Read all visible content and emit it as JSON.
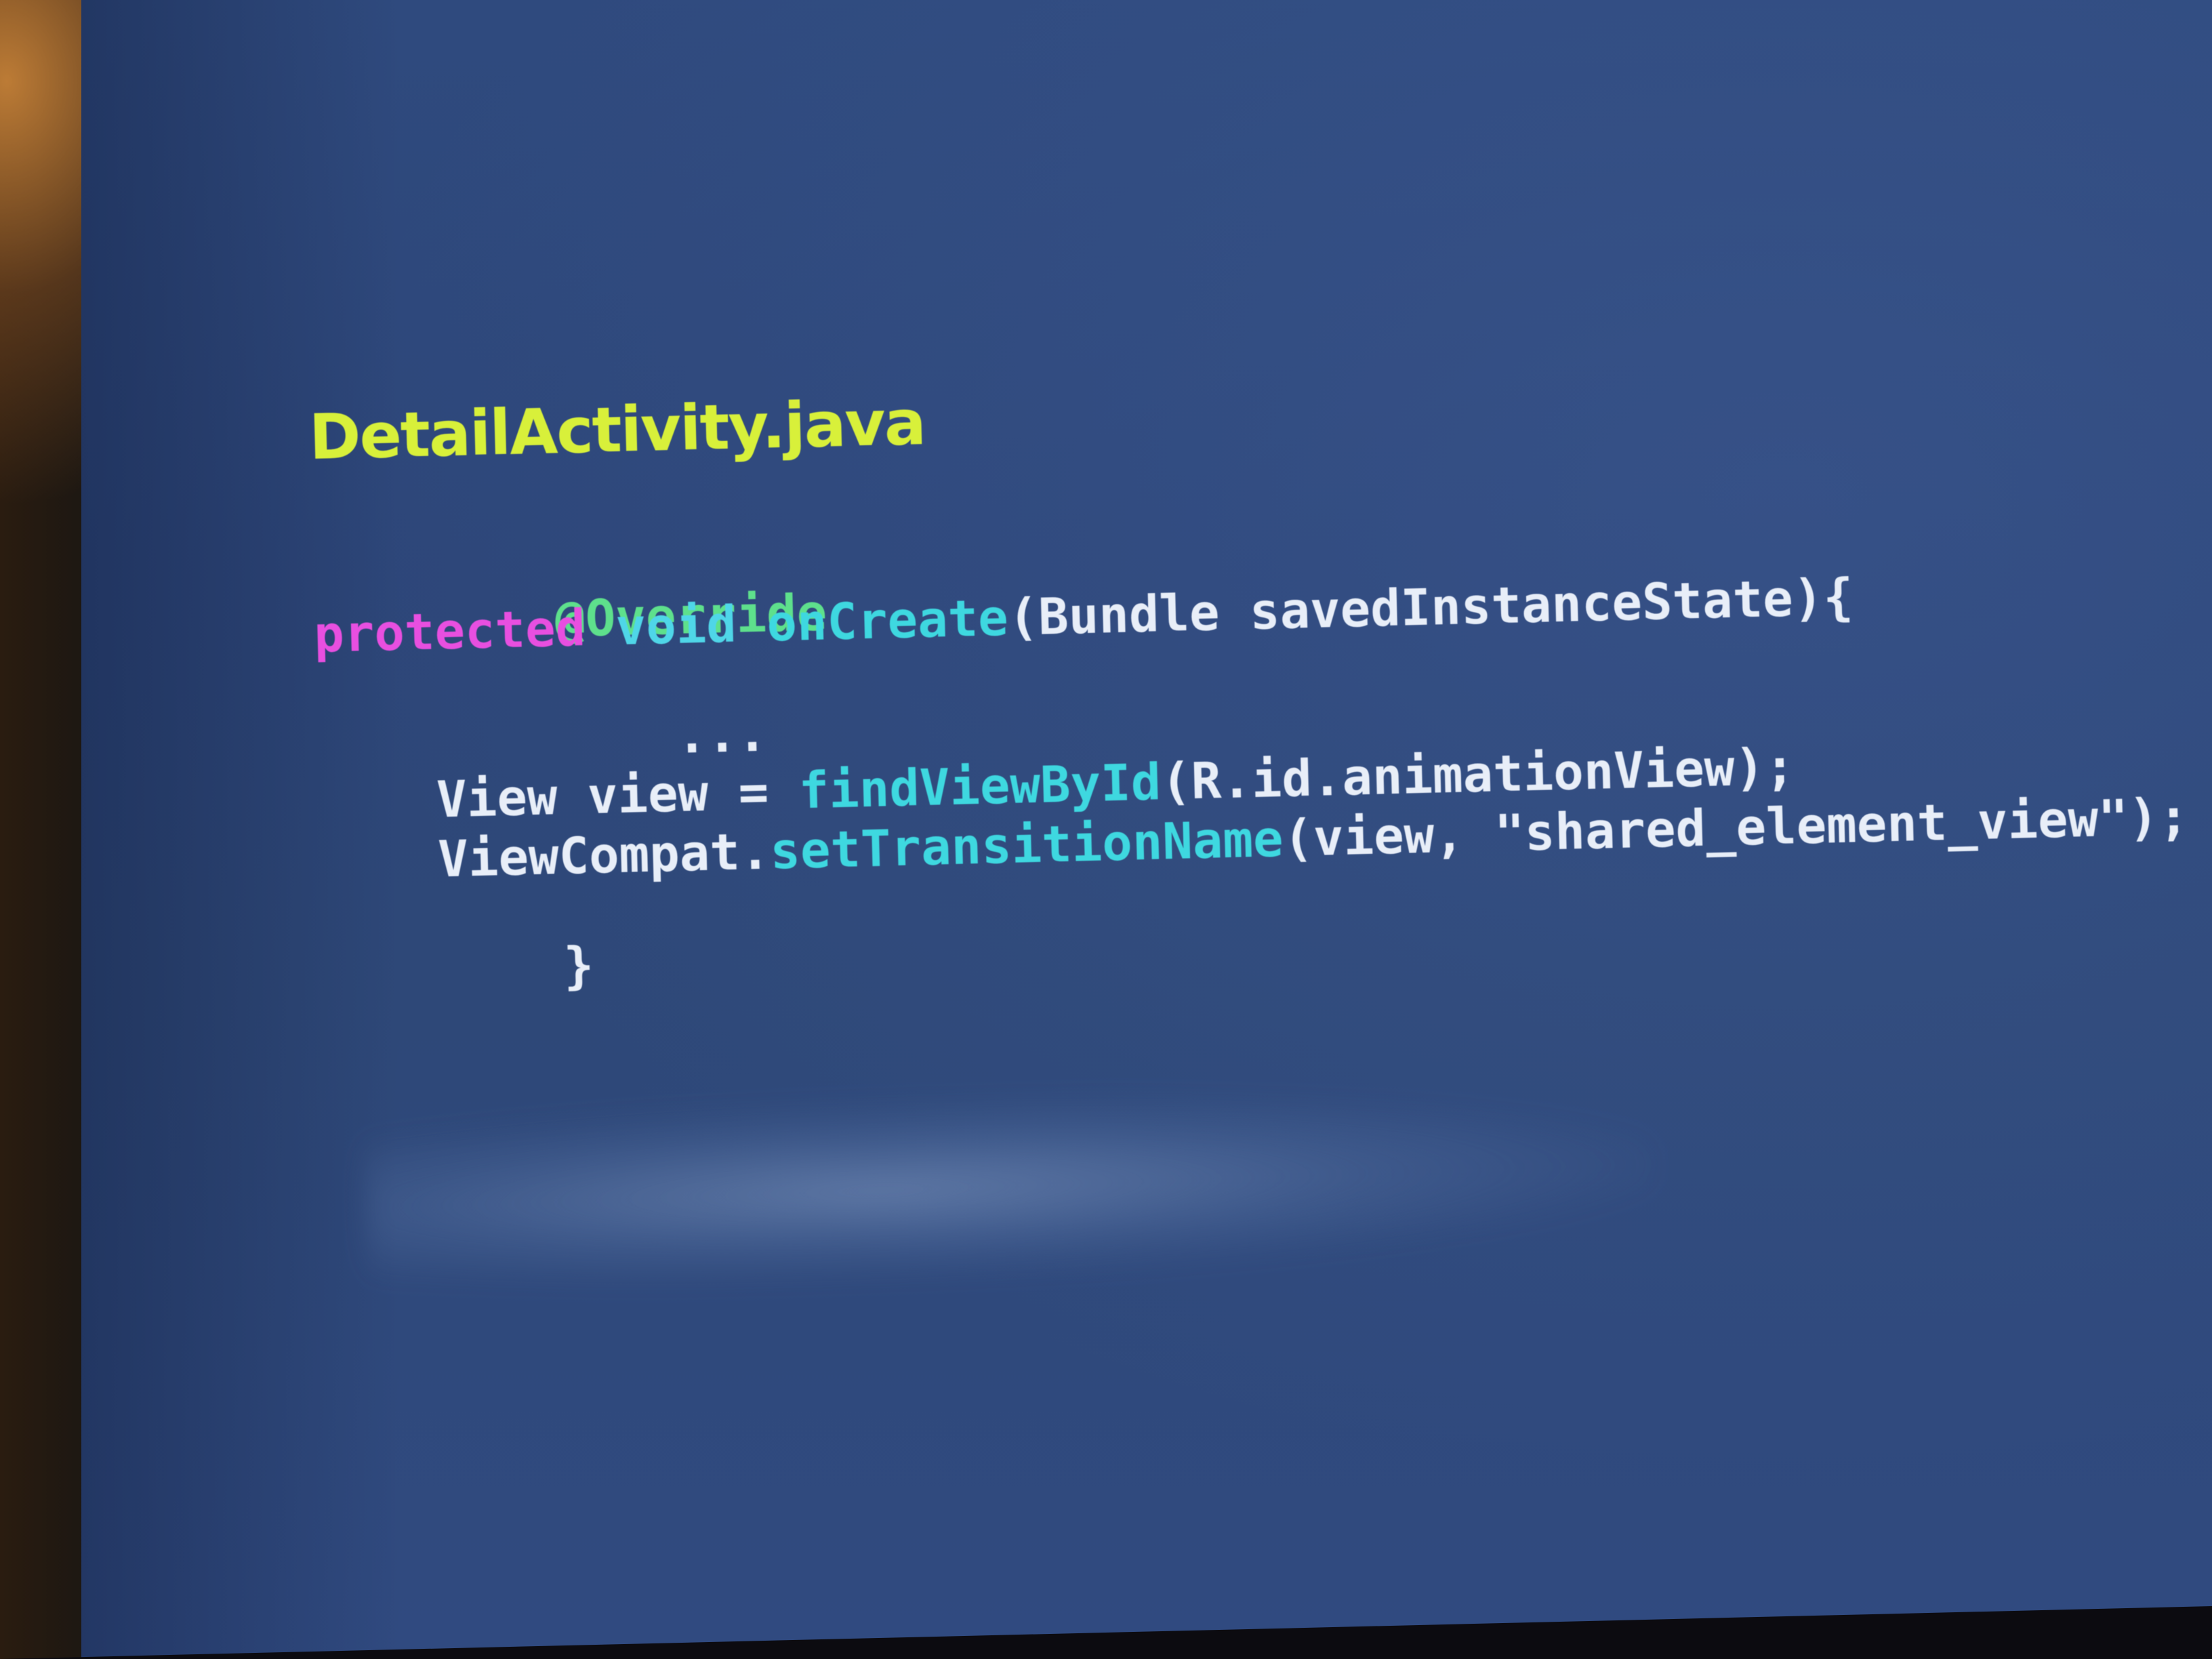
{
  "slide": {
    "filename": "DetailActivity.java",
    "colors": {
      "filename": "#d8f03a",
      "annotation": "#5ee08c",
      "modifier": "#e84fe0",
      "keyword": "#4fd6e8",
      "method": "#3ed8e0",
      "text": "#e8eef8",
      "background": "#2e4878"
    },
    "code": {
      "line1": {
        "annotation": "@Override"
      },
      "line2": {
        "modifier": "protected",
        "type": "void",
        "method": "onCreate",
        "rest": "(Bundle savedInstanceState){"
      },
      "line3": {
        "text": "..."
      },
      "line4": {
        "prefix": "View view = ",
        "method": "findViewById",
        "rest": "(R.id.animationView);"
      },
      "line5": {
        "prefix": "ViewCompat.",
        "method": "setTransitionName",
        "rest": "(view, \"shared_element_view\");"
      },
      "line6": {
        "text": "}"
      }
    }
  }
}
